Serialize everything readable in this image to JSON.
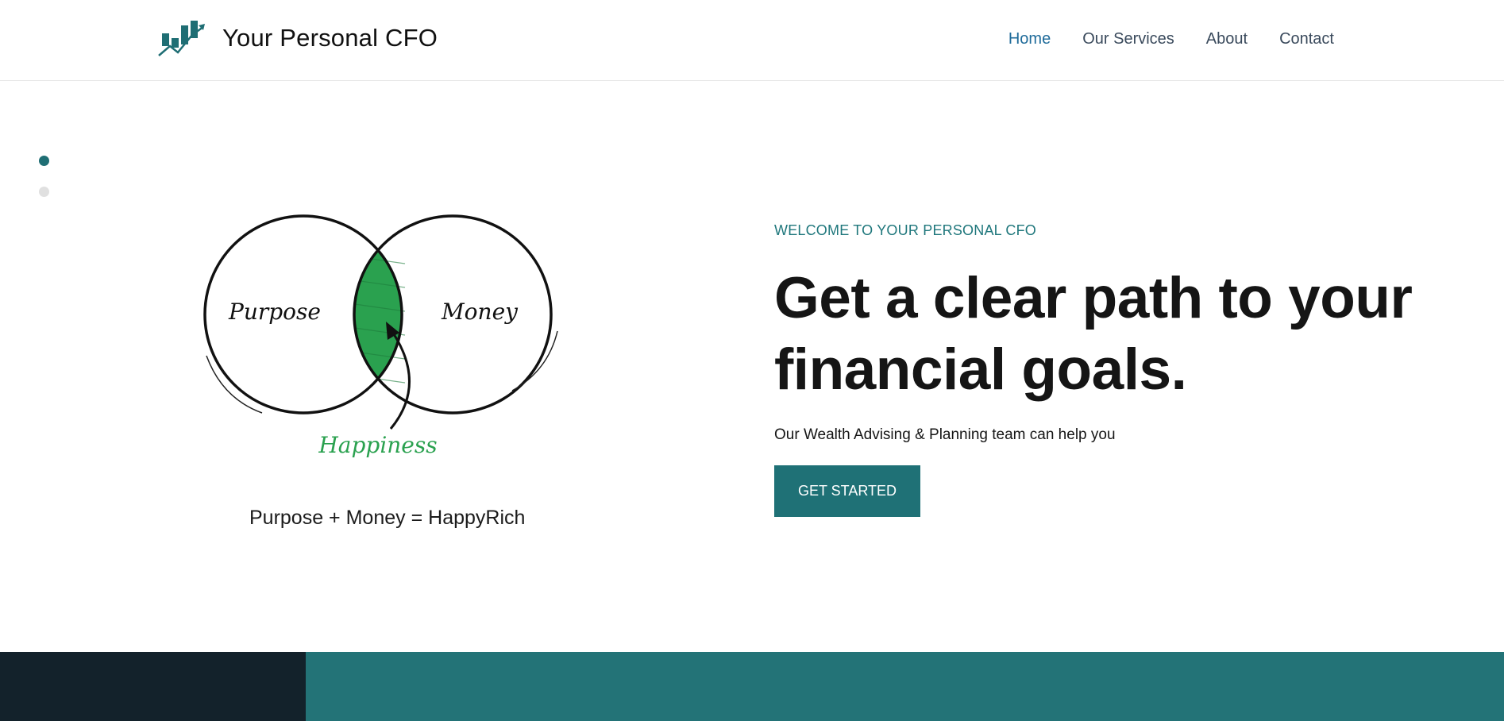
{
  "brand": {
    "name": "Your Personal CFO",
    "logo_icon": "rising-bar-chart-arrow-icon",
    "accent_color": "#1f7176"
  },
  "nav": {
    "items": [
      {
        "label": "Home",
        "active": true
      },
      {
        "label": "Our Services",
        "active": false
      },
      {
        "label": "About",
        "active": false
      },
      {
        "label": "Contact",
        "active": false
      }
    ]
  },
  "slider": {
    "slide_count": 2,
    "active_index": 0
  },
  "illustration": {
    "left_circle_label": "Purpose",
    "right_circle_label": "Money",
    "overlap_label": "Happiness",
    "caption": "Purpose + Money = HappyRich"
  },
  "hero": {
    "kicker": "WELCOME TO YOUR PERSONAL CFO",
    "headline_line1": "Get a clear path to your",
    "headline_line2": "financial goals.",
    "subtext": "Our Wealth Advising & Planning team can help you",
    "cta_label": "GET STARTED"
  },
  "colors": {
    "footer_dark": "#13222b",
    "footer_teal": "#237377",
    "nav_active": "#1f6b9a",
    "overlap_green": "#2aa14f"
  }
}
